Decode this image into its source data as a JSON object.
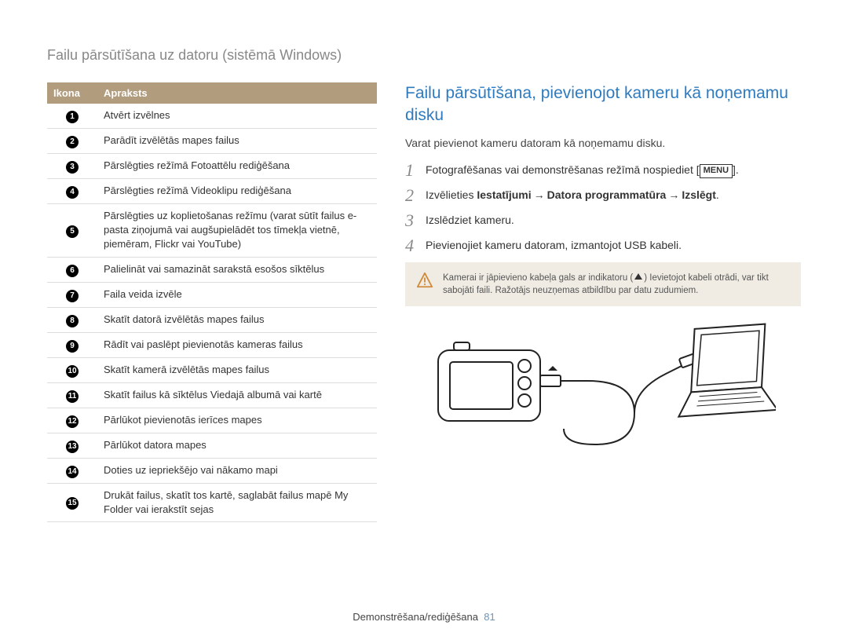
{
  "header": {
    "title": "Failu pārsūtīšana uz datoru (sistēmā Windows)"
  },
  "table": {
    "head": {
      "icon": "Ikona",
      "desc": "Apraksts"
    },
    "rows": [
      {
        "n": "1",
        "desc": "Atvērt izvēlnes"
      },
      {
        "n": "2",
        "desc": "Parādīt izvēlētās mapes failus"
      },
      {
        "n": "3",
        "desc": "Pārslēgties režīmā Fotoattēlu rediģēšana"
      },
      {
        "n": "4",
        "desc": "Pārslēgties režīmā Videoklipu rediģēšana"
      },
      {
        "n": "5",
        "desc": "Pārslēgties uz koplietošanas režīmu (varat sūtīt failus e-pasta ziņojumā vai augšupielādēt tos tīmekļa vietnē, piemēram, Flickr vai YouTube)"
      },
      {
        "n": "6",
        "desc": "Palielināt vai samazināt sarakstā esošos sīktēlus"
      },
      {
        "n": "7",
        "desc": "Faila veida izvēle"
      },
      {
        "n": "8",
        "desc": "Skatīt datorā izvēlētās mapes failus"
      },
      {
        "n": "9",
        "desc": "Rādīt vai paslēpt pievienotās kameras failus"
      },
      {
        "n": "10",
        "desc": "Skatīt kamerā izvēlētās mapes failus"
      },
      {
        "n": "11",
        "desc": "Skatīt failus kā sīktēlus Viedajā albumā vai kartē"
      },
      {
        "n": "12",
        "desc": "Pārlūkot pievienotās ierīces mapes"
      },
      {
        "n": "13",
        "desc": "Pārlūkot datora mapes"
      },
      {
        "n": "14",
        "desc": "Doties uz iepriekšējo vai nākamo mapi"
      },
      {
        "n": "15",
        "desc": "Drukāt failus, skatīt tos kartē, saglabāt failus mapē My Folder vai ierakstīt sejas"
      }
    ]
  },
  "section": {
    "heading": "Failu pārsūtīšana, pievienojot kameru kā noņemamu disku",
    "sub": "Varat pievienot kameru datoram kā noņemamu disku.",
    "steps": {
      "s1_pre": "Fotografēšanas vai demonstrēšanas režīmā nospiediet ",
      "s1_btn": "MENU",
      "s1_post": ".",
      "s2_pre": "Izvēlieties ",
      "s2_b1": "Iestatījumi",
      "s2_b2": "Datora programmatūra",
      "s2_b3": "Izslēgt",
      "s2_post": ".",
      "s3": "Izslēdziet kameru.",
      "s4": "Pievienojiet kameru datoram, izmantojot USB kabeli."
    },
    "note": "Kamerai ir jāpievieno kabeļa gals ar indikatoru (▲) Ievietojot kabeli otrādi, var tikt sabojāti faili. Ražotājs neuzņemas atbildību par datu zudumiem."
  },
  "footer": {
    "label": "Demonstrēšana/rediģēšana",
    "page": "81"
  }
}
